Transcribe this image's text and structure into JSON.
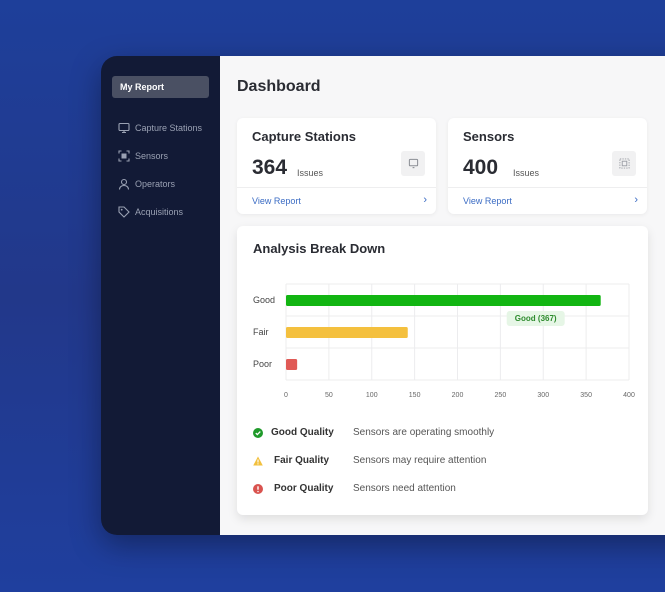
{
  "sidebar": {
    "active_item": "My Report",
    "items": [
      {
        "label": "Capture Stations",
        "icon": "monitor-icon"
      },
      {
        "label": "Sensors",
        "icon": "sensor-frame-icon"
      },
      {
        "label": "Operators",
        "icon": "user-icon"
      },
      {
        "label": "Acquisitions",
        "icon": "tag-icon"
      }
    ]
  },
  "main": {
    "title": "Dashboard",
    "cards": [
      {
        "title": "Capture Stations",
        "value": "364",
        "unit": "Issues",
        "link": "View Report",
        "chevron": "›",
        "icon": "monitor-icon"
      },
      {
        "title": "Sensors",
        "value": "400",
        "unit": "Issues",
        "link": "View Report",
        "chevron": "›",
        "icon": "sensor-frame-icon"
      }
    ],
    "analysis": {
      "title": "Analysis Break Down",
      "legend": [
        {
          "label": "Good Quality",
          "desc": "Sensors are operating smoothly",
          "icon": "check-circle-icon",
          "color": "#1f9a2a"
        },
        {
          "label": "Fair Quality",
          "desc": "Sensors may require attention",
          "icon": "warning-triangle-icon",
          "color": "#f2c03e"
        },
        {
          "label": "Poor Quality",
          "desc": "Sensors need attention",
          "icon": "exclamation-circle-icon",
          "color": "#d9534f"
        }
      ]
    }
  },
  "chart_data": {
    "type": "bar",
    "orientation": "horizontal",
    "categories": [
      "Good",
      "Fair",
      "Poor"
    ],
    "values": [
      367,
      142,
      13
    ],
    "colors": [
      "#12b512",
      "#f4c03e",
      "#e05a56"
    ],
    "xlim": [
      0,
      400
    ],
    "xticks": [
      0,
      50,
      100,
      150,
      200,
      250,
      300,
      350,
      400
    ],
    "grid": true,
    "tooltip": {
      "category": "Good",
      "text": "Good (367)"
    },
    "title": "",
    "xlabel": "",
    "ylabel": ""
  }
}
